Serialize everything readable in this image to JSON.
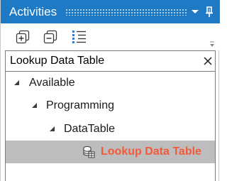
{
  "panel": {
    "title": "Activities"
  },
  "icons": {
    "title_dropdown": "chevron-down-icon",
    "title_pin": "pin-icon",
    "expand_all": "expand-all-icon",
    "collapse_all": "collapse-all-icon",
    "list_view": "list-view-icon",
    "search_clear": "close-icon",
    "activity": "database-table-icon"
  },
  "search": {
    "value": "Lookup Data Table"
  },
  "tree": {
    "nodes": [
      {
        "label": "Available",
        "expanded": true
      },
      {
        "label": "Programming",
        "expanded": true
      },
      {
        "label": "DataTable",
        "expanded": true
      },
      {
        "label": "Lookup Data Table",
        "selected": true
      }
    ]
  },
  "colors": {
    "titlebar": "#1e7ac4",
    "selection": "#bdbdbd",
    "match_highlight": "#f25a3c",
    "toolbar_icon_blue": "#3a78c9"
  }
}
